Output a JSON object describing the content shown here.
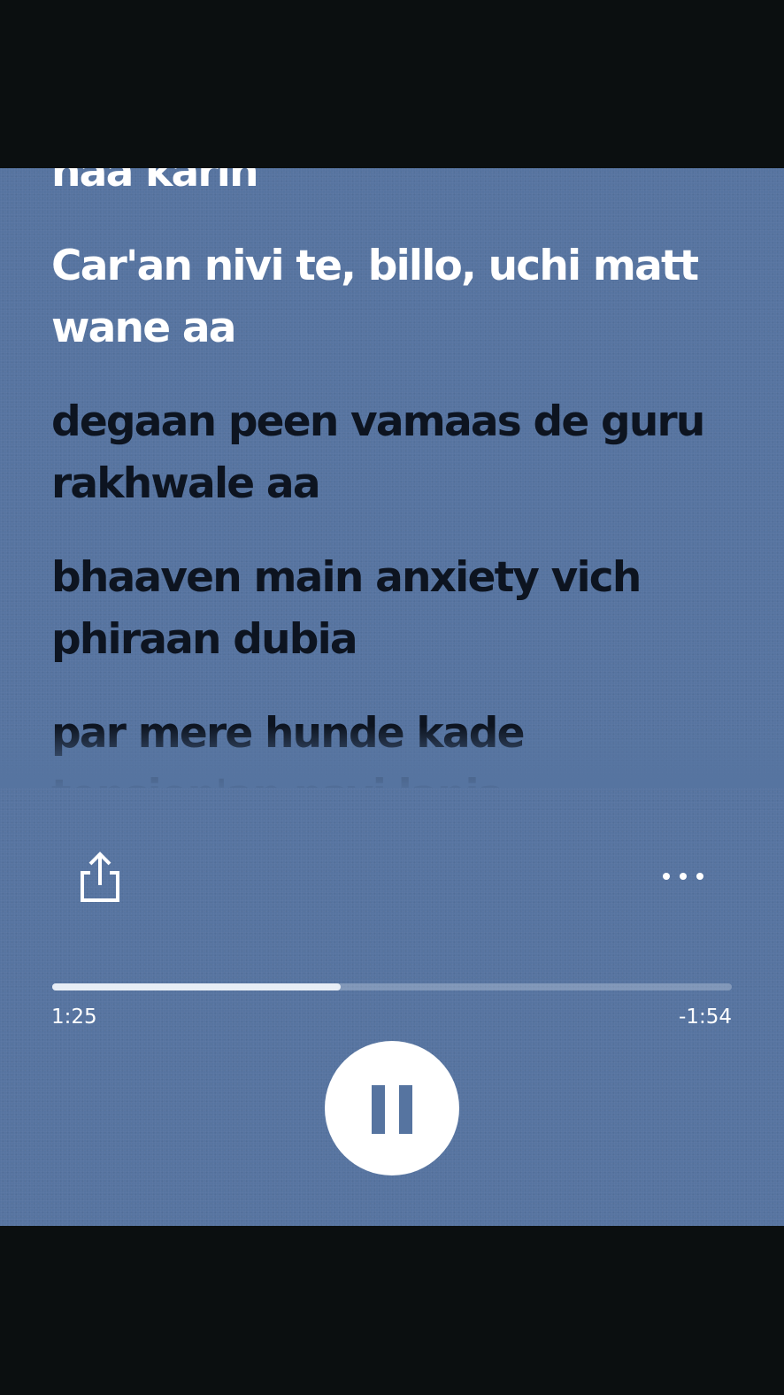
{
  "lyrics": {
    "lines": [
      {
        "text": "naa karin",
        "state": "past"
      },
      {
        "text": "Car'an nivi te, billo, uchi matt wane aa",
        "state": "current"
      },
      {
        "text": "degaan peen vamaas de guru rakhwale aa",
        "state": "upcoming"
      },
      {
        "text": "bhaaven main anxiety vich phiraan dubia",
        "state": "upcoming"
      },
      {
        "text": "par mere hunde kade tension'an nayi lania",
        "state": "upcoming"
      }
    ]
  },
  "actions": {
    "share_icon": "share-icon",
    "more_icon": "more-horizontal-icon"
  },
  "player": {
    "elapsed": "1:25",
    "remaining": "-1:54",
    "progress_fraction": 0.4246,
    "state": "playing",
    "play_pause_icon": "pause-icon"
  },
  "colors": {
    "background": "#5674a0",
    "letterbox": "#0b0f10",
    "active_text": "#ffffff",
    "upcoming_text": "#0d1420"
  }
}
